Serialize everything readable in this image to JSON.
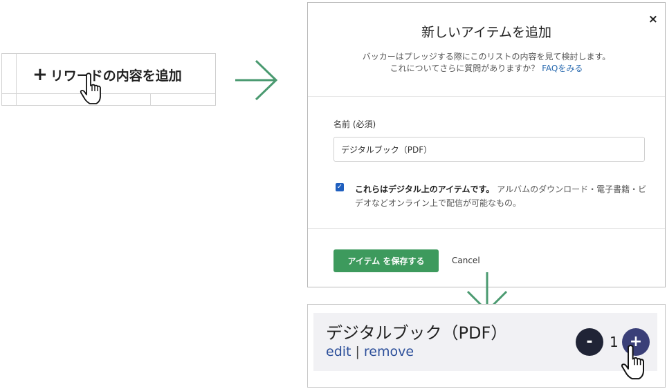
{
  "add_panel": {
    "plus_symbol": "+",
    "add_label": "リワードの内容を追加"
  },
  "modal": {
    "title": "新しいアイテムを追加",
    "close_symbol": "×",
    "desc_line1": "バッカーはプレッジする際にこのリストの内容を見て検討します。",
    "desc_line2_prefix": "これについてさらに質問がありますか？ ",
    "faq_link": "FAQをみる",
    "name_label": "名前 (必須)",
    "name_value": "デジタルブック（PDF）",
    "digital_checked": true,
    "digital_bold": "これらはデジタル上のアイテムです。",
    "digital_desc": " アルバムのダウンロード・電子書籍・ビデオなどオンライン上で配信が可能なもの。",
    "save_label": "アイテム を保存する",
    "cancel_label": "Cancel"
  },
  "result": {
    "item_title": "デジタルブック（PDF）",
    "edit_label": "edit",
    "separator": "|",
    "remove_label": "remove",
    "minus_symbol": "-",
    "quantity": "1",
    "plus_symbol": "+"
  },
  "colors": {
    "arrow": "#4a9a70",
    "save_button": "#3d9a5d",
    "link": "#2c4f9a",
    "minus_button": "#202436",
    "plus_button": "#3a3f78"
  }
}
